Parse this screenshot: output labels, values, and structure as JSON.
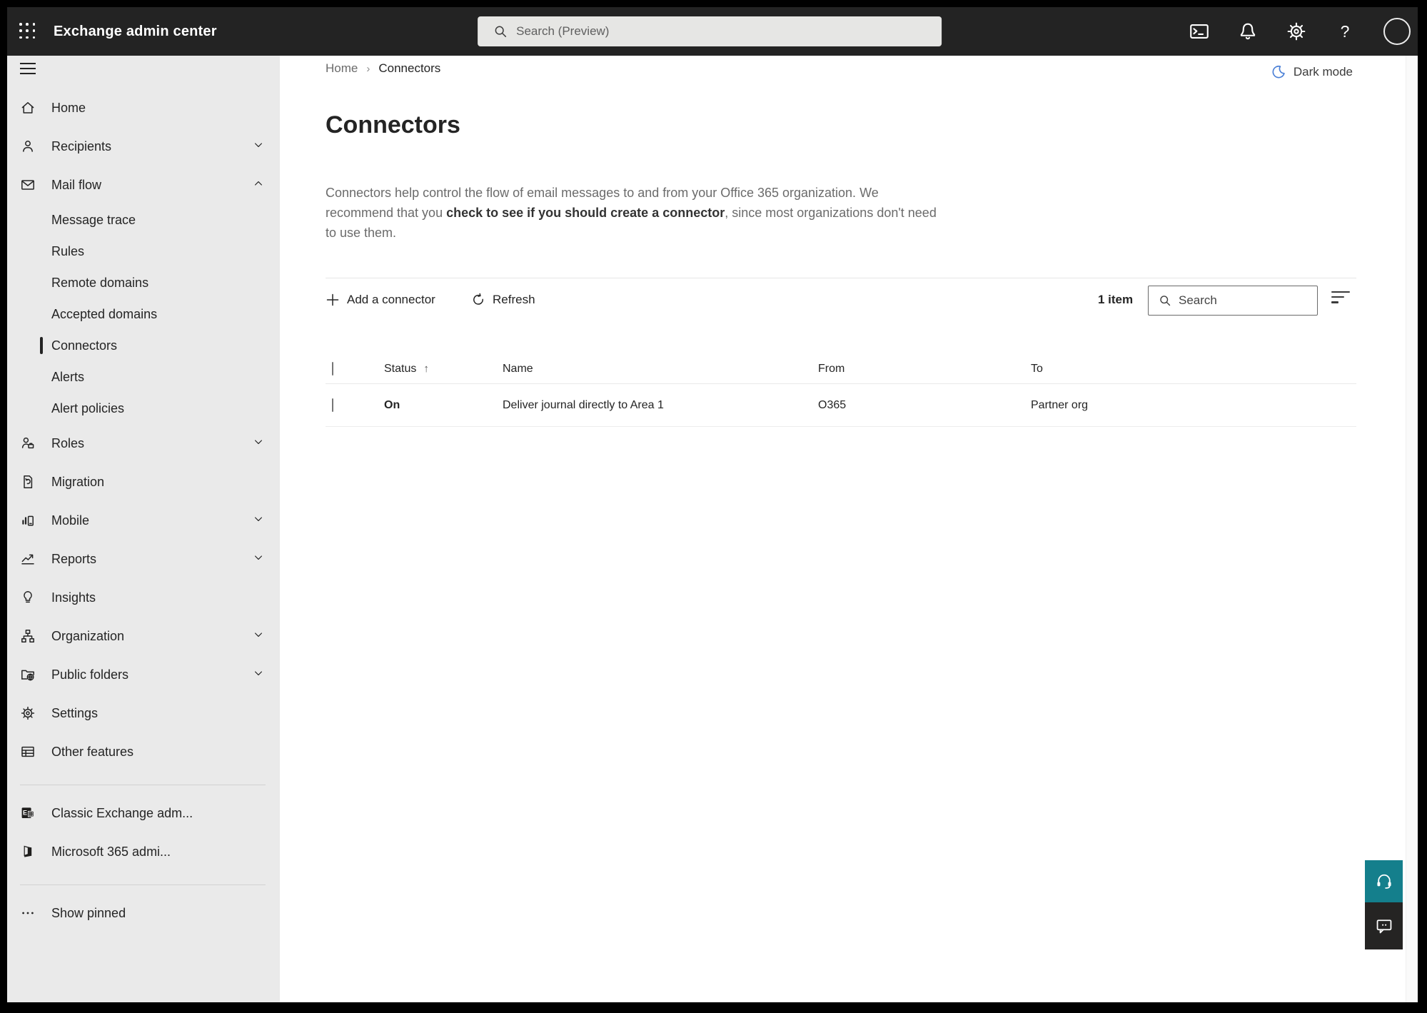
{
  "colors": {
    "topbar_bg": "#232323",
    "sidebar_bg": "#eaeaea",
    "accent_teal": "#147f8c",
    "darkmode_blue": "#4a7fd6",
    "text_primary": "#242424",
    "text_secondary": "#6b6b6b"
  },
  "topbar": {
    "title": "Exchange admin center",
    "search_placeholder": "Search (Preview)",
    "right_icons": [
      "terminal-icon",
      "bell-icon",
      "gear-icon",
      "help-icon",
      "avatar"
    ]
  },
  "breadcrumb": {
    "home": "Home",
    "separator": "›",
    "current": "Connectors"
  },
  "darkmode": {
    "label": "Dark mode",
    "icon": "moon-icon"
  },
  "sidebar": {
    "items": [
      {
        "label": "Home",
        "icon": "home"
      },
      {
        "label": "Recipients",
        "icon": "recipients",
        "chevron": "down"
      },
      {
        "label": "Mail flow",
        "icon": "mail-flow",
        "chevron": "up"
      },
      {
        "label": "Message trace",
        "type": "sub"
      },
      {
        "label": "Rules",
        "type": "sub"
      },
      {
        "label": "Remote domains",
        "type": "sub"
      },
      {
        "label": "Accepted domains",
        "type": "sub"
      },
      {
        "label": "Connectors",
        "type": "sub",
        "selected": true
      },
      {
        "label": "Alerts",
        "type": "sub"
      },
      {
        "label": "Alert policies",
        "type": "sub"
      },
      {
        "label": "Roles",
        "icon": "roles",
        "chevron": "down"
      },
      {
        "label": "Migration",
        "icon": "migration"
      },
      {
        "label": "Mobile",
        "icon": "mobile",
        "chevron": "down"
      },
      {
        "label": "Reports",
        "icon": "reports",
        "chevron": "down"
      },
      {
        "label": "Insights",
        "icon": "insights"
      },
      {
        "label": "Organization",
        "icon": "organization",
        "chevron": "down"
      },
      {
        "label": "Public folders",
        "icon": "public-folders",
        "chevron": "down"
      },
      {
        "label": "Settings",
        "icon": "settings"
      },
      {
        "label": "Other features",
        "icon": "other-features"
      },
      {
        "type": "divider"
      },
      {
        "label": "Classic Exchange adm...",
        "icon": "classic-exchange"
      },
      {
        "label": "Microsoft 365 admi...",
        "icon": "microsoft-365"
      },
      {
        "type": "divider"
      },
      {
        "label": "Show pinned",
        "icon": "show-pinned"
      }
    ]
  },
  "page": {
    "title": "Connectors",
    "description": {
      "before": "Connectors help control the flow of email messages to and from your Office 365 organization. We recommend that you ",
      "link": "check to see if you should create a connector",
      "after": ", since most organizations don't need to use them."
    },
    "toolbar": {
      "add_label": "Add a connector",
      "refresh_label": "Refresh",
      "count": "1 item",
      "search_placeholder": "Search"
    },
    "table": {
      "columns": [
        "Status",
        "Name",
        "From",
        "To"
      ],
      "sorted_column": "Status",
      "sort_direction": "up",
      "rows": [
        {
          "status": "On",
          "name": "Deliver journal directly to Area 1",
          "from": "O365",
          "to": "Partner org"
        }
      ]
    }
  },
  "rail": {
    "buttons": [
      "headset-icon",
      "feedback-icon"
    ]
  }
}
